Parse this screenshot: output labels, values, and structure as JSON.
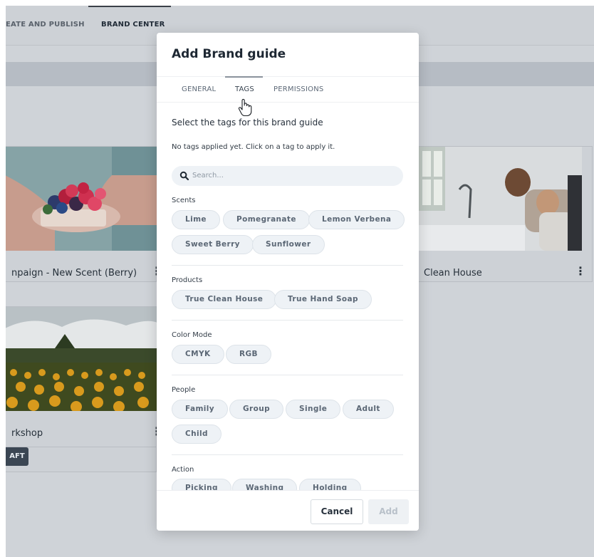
{
  "background": {
    "nav_tabs": [
      "EATE AND PUBLISH",
      "BRAND CENTER"
    ],
    "cards": [
      {
        "title": "npaign - New Scent (Berry)"
      },
      {
        "title": "Clean House"
      },
      {
        "title": "rkshop",
        "badge": "AFT"
      }
    ]
  },
  "modal": {
    "title": "Add Brand guide",
    "tabs": [
      {
        "label": "GENERAL"
      },
      {
        "label": "TAGS",
        "active": true
      },
      {
        "label": "PERMISSIONS"
      }
    ],
    "intro": "Select the tags for this brand guide",
    "hint": "No tags applied yet. Click on a tag to apply it.",
    "search": {
      "placeholder": "Search..."
    },
    "groups": [
      {
        "label": "Scents",
        "tags": [
          "Lime",
          "Pomegranate",
          "Lemon Verbena",
          "Sweet Berry",
          "Sunflower"
        ]
      },
      {
        "label": "Products",
        "tags": [
          "True Clean House",
          "True Hand Soap"
        ]
      },
      {
        "label": "Color Mode",
        "tags": [
          "CMYK",
          "RGB"
        ]
      },
      {
        "label": "People",
        "tags": [
          "Family",
          "Group",
          "Single",
          "Adult",
          "Child"
        ]
      },
      {
        "label": "Action",
        "tags": [
          "Picking",
          "Washing",
          "Holding"
        ]
      }
    ],
    "footer": {
      "cancel_label": "Cancel",
      "add_label": "Add"
    }
  },
  "colors": {
    "overlay": "#cfd3d8",
    "chip_bg": "#eef2f6",
    "badge_bg": "#3b4653"
  },
  "icons": {
    "search": "search-icon",
    "kebab": "kebab-menu-icon",
    "cursor": "hand-pointer-icon"
  }
}
